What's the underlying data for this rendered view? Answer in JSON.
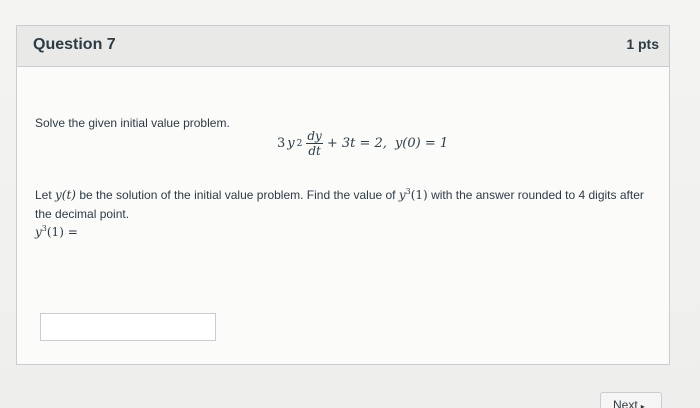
{
  "question": {
    "title": "Question 7",
    "points": "1 pts"
  },
  "body": {
    "prompt": "Solve the given initial value problem.",
    "equation": {
      "coef": "3",
      "var": "y",
      "exp": "2",
      "frac_num": "dy",
      "frac_den": "dt",
      "rest": "+ 3t = 2,",
      "ic": "y(0) = 1"
    },
    "instruction": {
      "part1": "Let ",
      "fn": "y(t)",
      "part2": " be the solution of the initial value problem. Find the value of ",
      "y3_var": "y",
      "y3_exp": "3",
      "y3_arg": "(1)",
      "part3": " with the answer rounded to 4 digits after the decimal point."
    },
    "answer_label": {
      "var": "y",
      "exp": "3",
      "rest": "(1) ="
    }
  },
  "answer": {
    "value": "",
    "placeholder": ""
  },
  "nav": {
    "next_label": "Next",
    "next_arrow": "▸"
  }
}
